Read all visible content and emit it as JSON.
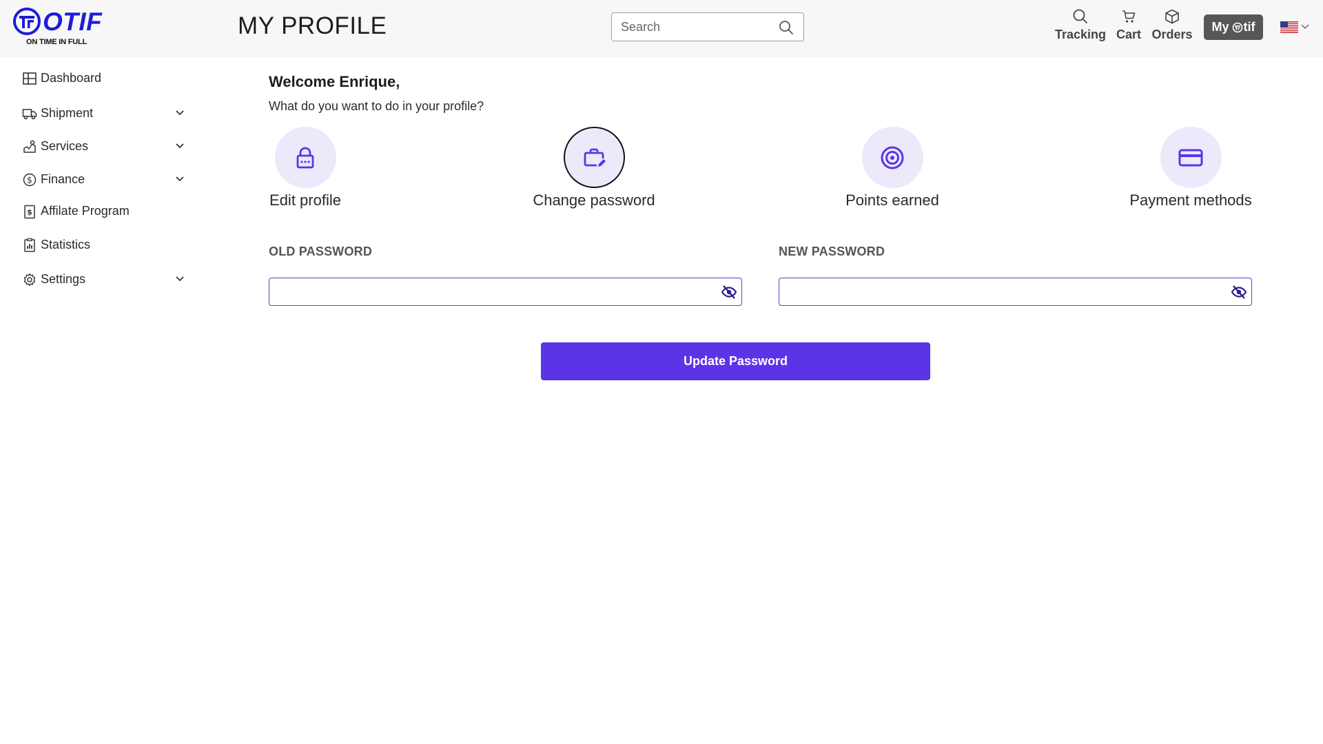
{
  "brand": {
    "name": "OTIF",
    "tagline": "ON TIME IN FULL",
    "color": "#1d1dd9"
  },
  "header": {
    "title": "MY PROFILE",
    "search": {
      "placeholder": "Search",
      "value": ""
    },
    "nav": [
      {
        "label": "Tracking",
        "icon": "search-icon"
      },
      {
        "label": "Cart",
        "icon": "cart-icon"
      },
      {
        "label": "Orders",
        "icon": "box-icon"
      }
    ],
    "my_otif": {
      "prefix": "My",
      "suffix": "tif"
    },
    "language": {
      "flag": "us-flag-icon"
    }
  },
  "sidebar": {
    "items": [
      {
        "label": "Dashboard",
        "icon": "dashboard-icon",
        "expandable": false
      },
      {
        "label": "Shipment",
        "icon": "truck-icon",
        "expandable": true
      },
      {
        "label": "Services",
        "icon": "services-icon",
        "expandable": true
      },
      {
        "label": "Finance",
        "icon": "dollar-icon",
        "expandable": true
      },
      {
        "label": "Affilate Program",
        "icon": "affiliate-icon",
        "expandable": false
      },
      {
        "label": "Statistics",
        "icon": "statistics-icon",
        "expandable": false
      },
      {
        "label": "Settings",
        "icon": "gear-icon",
        "expandable": true
      }
    ]
  },
  "main": {
    "welcome": "Welcome Enrique,",
    "subtitle": "What do you want to do in your profile?",
    "actions": [
      {
        "label": "Edit profile",
        "icon": "lock-icon",
        "active": false
      },
      {
        "label": "Change password",
        "icon": "briefcase-edit-icon",
        "active": true
      },
      {
        "label": "Points earned",
        "icon": "target-icon",
        "active": false
      },
      {
        "label": "Payment methods",
        "icon": "credit-card-icon",
        "active": false
      }
    ],
    "form": {
      "old_password_label": "OLD PASSWORD",
      "old_password_value": "",
      "new_password_label": "NEW PASSWORD",
      "new_password_value": "",
      "submit_label": "Update Password"
    }
  },
  "colors": {
    "accent": "#5b34e8",
    "icon_bg": "#ece9fb",
    "header_bg": "#f7f7f7"
  }
}
